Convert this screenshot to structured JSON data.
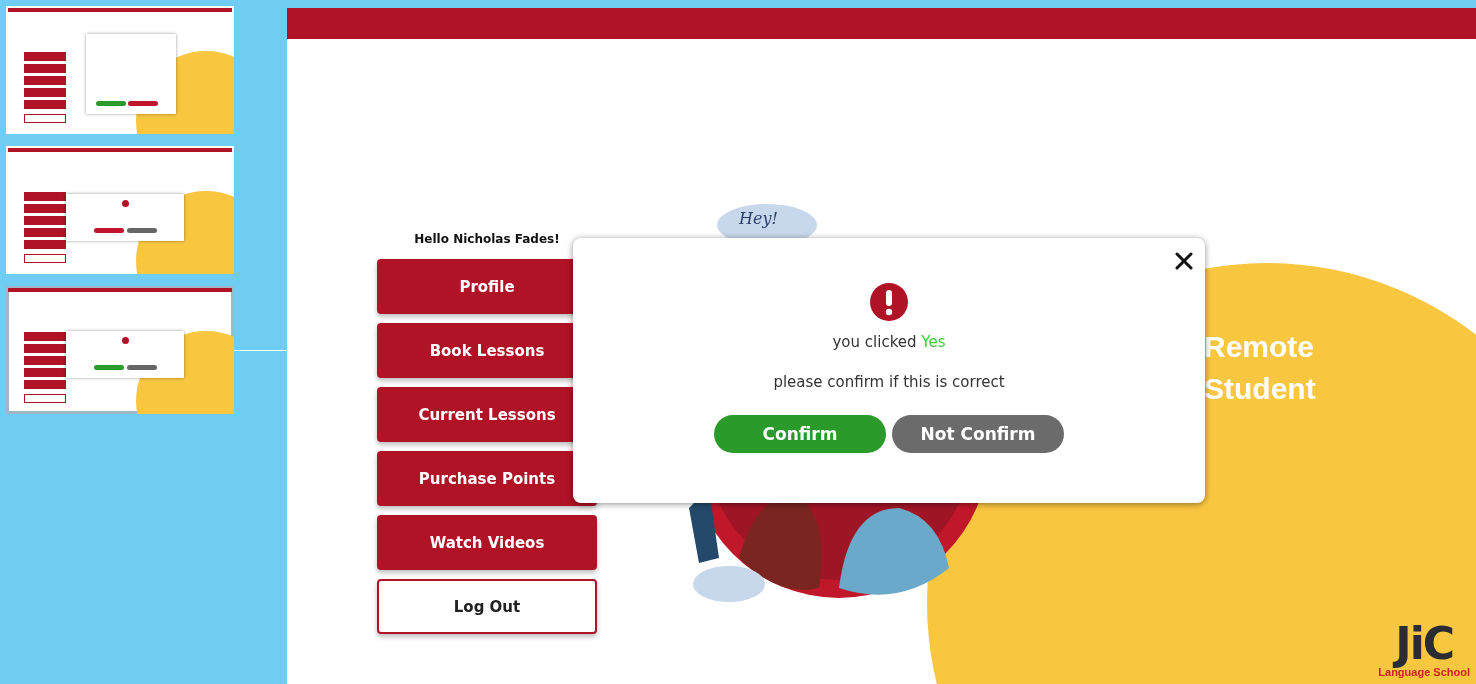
{
  "thumbnails": [
    {
      "kind": "profile",
      "selected": false
    },
    {
      "kind": "confirm-no",
      "selected": false
    },
    {
      "kind": "confirm-yes",
      "selected": true
    }
  ],
  "slide": {
    "greeting": "Hello Nicholas Fades!",
    "menu": [
      {
        "label": "Profile",
        "kind": "primary"
      },
      {
        "label": "Book Lessons",
        "kind": "primary"
      },
      {
        "label": "Current Lessons",
        "kind": "primary"
      },
      {
        "label": "Purchase Points",
        "kind": "primary"
      },
      {
        "label": "Watch Videos",
        "kind": "primary"
      },
      {
        "label": "Log Out",
        "kind": "outline"
      }
    ],
    "bubble": "Hey!",
    "heading": [
      "Remote",
      "Student"
    ],
    "logo": {
      "mark": "JiC",
      "subtitle": "Language School"
    },
    "dialog": {
      "message": "you clicked",
      "choice": "Yes",
      "prompt": "please confirm if this is correct",
      "buttons": [
        {
          "label": "Confirm",
          "kind": "confirm"
        },
        {
          "label": "Not Confirm",
          "kind": "cancel"
        }
      ]
    }
  }
}
